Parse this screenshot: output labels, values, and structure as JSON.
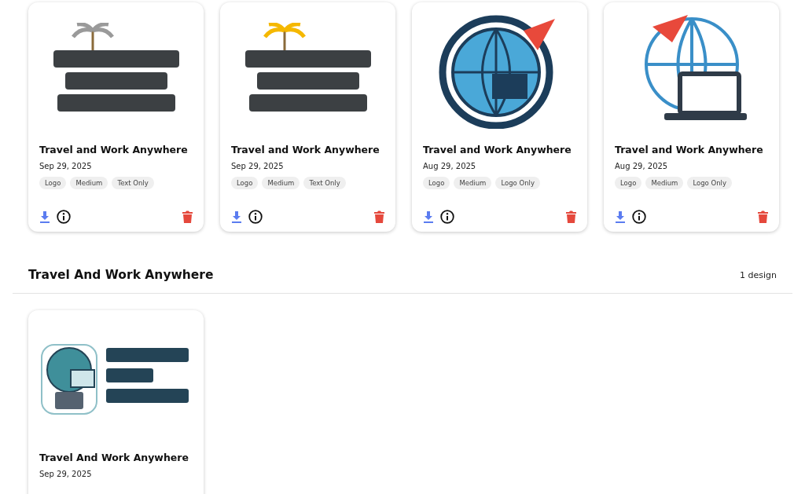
{
  "groups": [
    {
      "designs": [
        {
          "kind": "palms",
          "title": "Travel and Work Anywhere",
          "date": "Sep 29, 2025",
          "tags": [
            "Logo",
            "Medium",
            "Text Only"
          ]
        },
        {
          "kind": "palm",
          "title": "Travel and Work Anywhere",
          "date": "Sep 29, 2025",
          "tags": [
            "Logo",
            "Medium",
            "Text Only"
          ]
        },
        {
          "kind": "globe",
          "title": "Travel and Work Anywhere",
          "date": "Aug 29, 2025",
          "tags": [
            "Logo",
            "Medium",
            "Logo Only"
          ]
        },
        {
          "kind": "laptop",
          "title": "Travel and Work Anywhere",
          "date": "Aug 29, 2025",
          "tags": [
            "Logo",
            "Medium",
            "Logo Only"
          ]
        }
      ]
    },
    {
      "heading": "Travel And Work Anywhere",
      "count": "1 design",
      "designs": [
        {
          "kind": "badge",
          "title": "Travel And Work Anywhere",
          "date": "Sep 29, 2025"
        }
      ]
    }
  ]
}
